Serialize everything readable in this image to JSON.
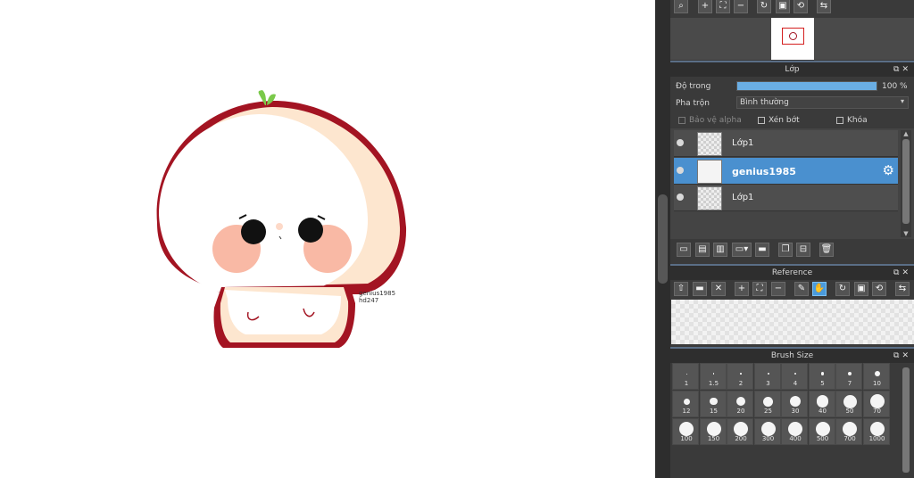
{
  "canvas": {
    "signature_line1": "genius1985",
    "signature_line2": "hd247"
  },
  "navigator": {
    "toolbar_icons": [
      "zoom-fit-icon",
      "zoom-in-icon",
      "fit-window-icon",
      "zoom-out-icon",
      "rotate-icon",
      "fullscreen-icon",
      "rotate-reset-icon",
      "flip-icon"
    ]
  },
  "layer_panel": {
    "title": "Lớp",
    "opacity_label": "Độ trong",
    "opacity_value": "100 %",
    "opacity_fraction": 1.0,
    "blend_label": "Pha trộn",
    "blend_value": "Bình thường",
    "protect_alpha_label": "Bảo vệ alpha",
    "clipping_label": "Xén bớt",
    "lock_label": "Khóa",
    "layers": [
      {
        "name": "Lớp1",
        "selected": false
      },
      {
        "name": "genius1985",
        "selected": true
      },
      {
        "name": "Lớp1",
        "selected": false
      }
    ],
    "toolbar_icons": [
      "new-layer-icon",
      "new-raster-icon",
      "new-halftone-icon",
      "add-layer-dropdown-icon",
      "folder-icon",
      "duplicate-icon",
      "merge-icon",
      "delete-icon"
    ]
  },
  "reference_panel": {
    "title": "Reference",
    "toolbar_icons": [
      "upload-icon",
      "open-folder-icon",
      "close-icon",
      "zoom-in-icon",
      "fit-icon",
      "zoom-out-icon",
      "eyedropper-icon",
      "hand-icon",
      "rotate-icon",
      "fullscreen-icon",
      "rotate-reset-icon",
      "flip-icon"
    ]
  },
  "brush_panel": {
    "title": "Brush Size",
    "sizes": [
      "1",
      "1.5",
      "2",
      "3",
      "4",
      "5",
      "7",
      "10",
      "12",
      "15",
      "20",
      "25",
      "30",
      "40",
      "50",
      "70",
      "100",
      "150",
      "200",
      "300",
      "400",
      "500",
      "700",
      "1000"
    ]
  },
  "colors": {
    "accent": "#4a90cf",
    "panel_bg": "#3a3a3a"
  }
}
